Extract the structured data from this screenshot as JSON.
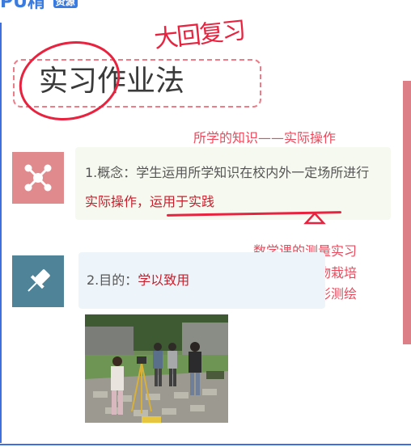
{
  "brand": {
    "logo_text": "PU精 ",
    "logo_box": "资源"
  },
  "annotations": {
    "handwritten": "大回复习",
    "top_note": "所学的知识——实际操作",
    "examples": [
      "数学课的测量实习",
      "生物课的植物栽培",
      "地理课的地形测绘"
    ]
  },
  "slide": {
    "title": "实习作业法",
    "point1": {
      "prefix": "1.概念：学生运用所学知识在校内外一定场所进行",
      "highlight": "实际操作，运用于实践",
      "icon": "network-nodes-icon"
    },
    "point2": {
      "prefix": "2.目的：",
      "highlight": "学以致用",
      "icon": "pushpin-icon"
    }
  },
  "colors": {
    "accent_blue": "#3d6fe0",
    "annotation_red": "#e8233f",
    "highlight_red": "#c81e2c",
    "icon_pink": "#e08a8e",
    "icon_teal": "#4f8398"
  }
}
